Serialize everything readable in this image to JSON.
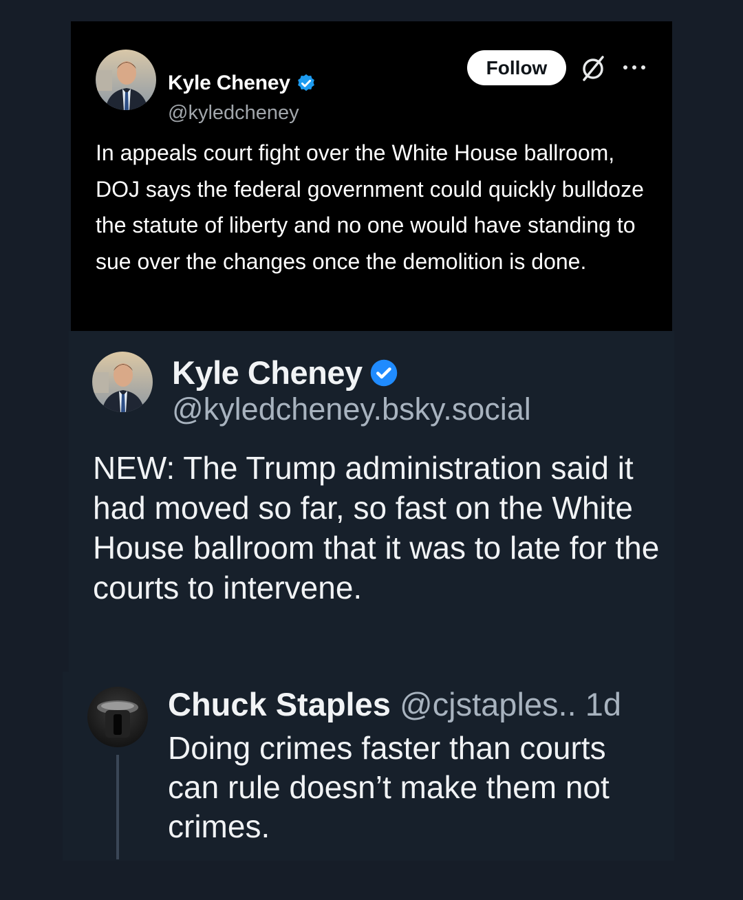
{
  "x_post": {
    "author_name": "Kyle Cheney",
    "author_handle": "@kyledcheney",
    "follow_label": "Follow",
    "verified": true,
    "icons": [
      "grok-icon",
      "more-icon"
    ],
    "text": "In appeals court fight over the White House ballroom, DOJ says the federal government could quickly bulldoze the statute of liberty and no one would have standing to sue over the changes once the demolition is done."
  },
  "bsky_post": {
    "author_name": "Kyle Cheney",
    "author_handle": "@kyledcheney.bsky.social",
    "verified": true,
    "text": "NEW: The Trump administration said it had moved so far, so fast on the White House ballroom that it was to late for the courts to intervene."
  },
  "reply": {
    "author_name": "Chuck Staples",
    "author_handle": "@cjstaples..",
    "time": "1d",
    "text": "Doing crimes faster than courts can rule doesn’t make them not crimes."
  },
  "colors": {
    "page_bg": "#161d28",
    "x_card_bg": "#000000",
    "verified_blue": "#1d9bf0",
    "bsky_verified_blue": "#208bfe"
  }
}
